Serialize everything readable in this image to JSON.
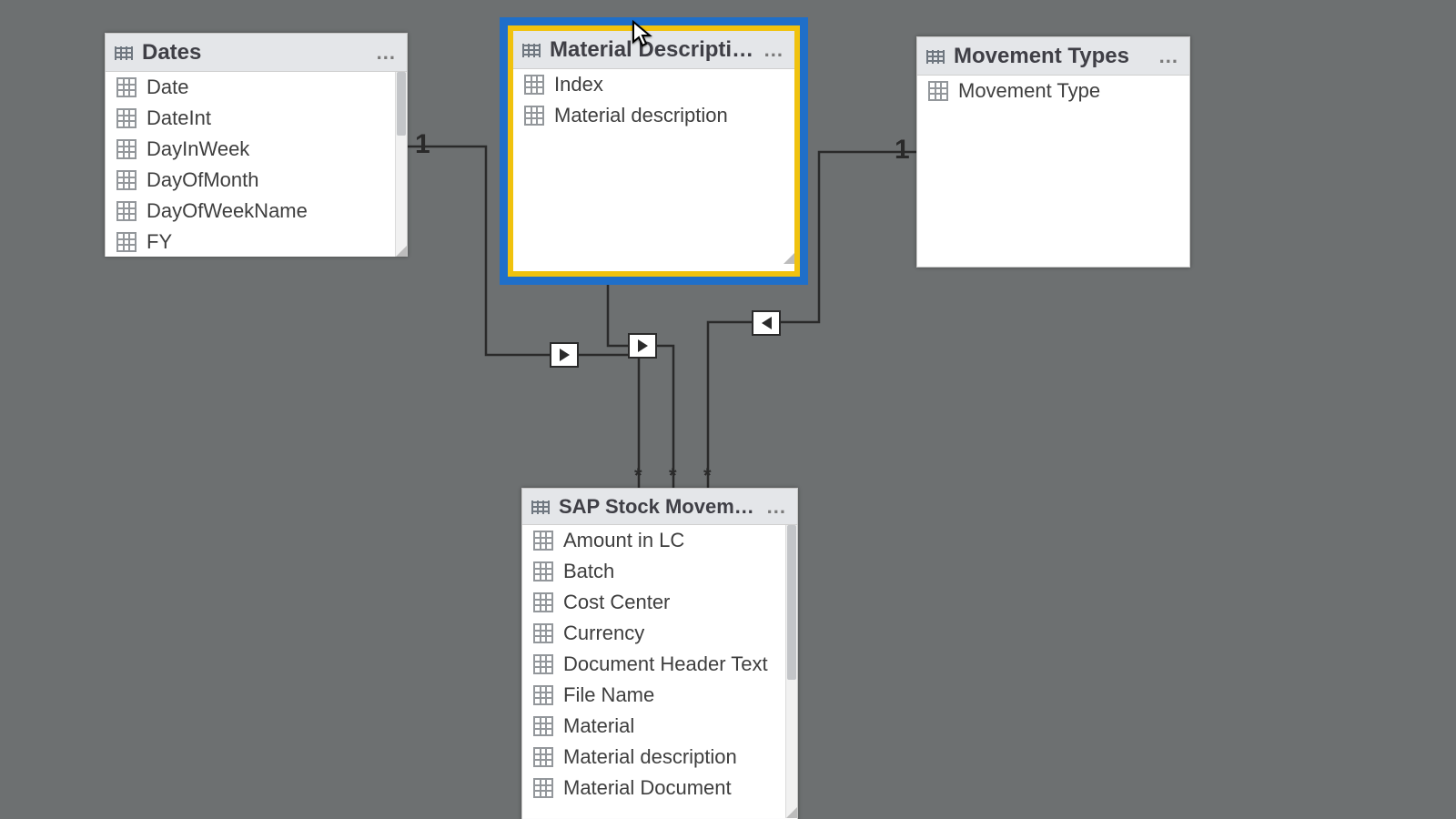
{
  "tables": {
    "dates": {
      "title": "Dates",
      "fields": [
        "Date",
        "DateInt",
        "DayInWeek",
        "DayOfMonth",
        "DayOfWeekName",
        "FY"
      ],
      "more": "..."
    },
    "material": {
      "title": "Material Description",
      "fields": [
        "Index",
        "Material description"
      ],
      "more": "..."
    },
    "movement": {
      "title": "Movement Types",
      "fields": [
        "Movement Type"
      ],
      "more": "..."
    },
    "sap": {
      "title": "SAP Stock Movements",
      "fields": [
        "Amount in LC",
        "Batch",
        "Cost Center",
        "Currency",
        "Document Header Text",
        "File Name",
        "Material",
        "Material description",
        "Material Document"
      ],
      "more": "..."
    }
  },
  "cardinality": {
    "one": "1",
    "many": "*"
  },
  "colors": {
    "selected_outer": "#1f6fc9",
    "selected_inner": "#f0c20e"
  }
}
